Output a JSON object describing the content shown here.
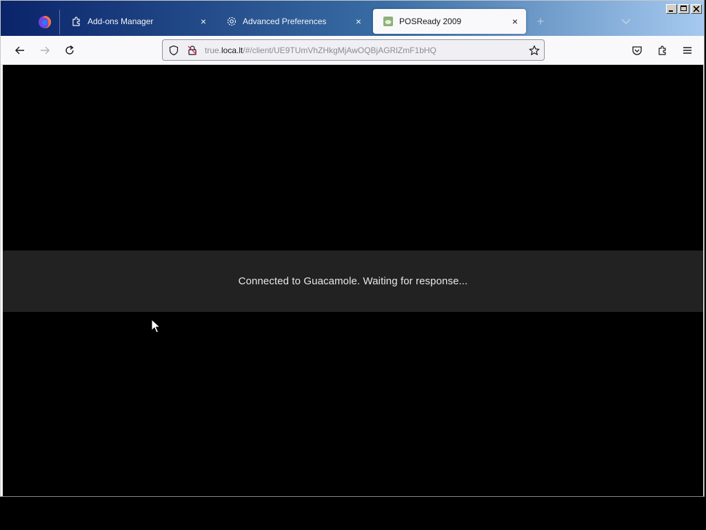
{
  "browser": {
    "tabs": [
      {
        "label": "Add-ons Manager",
        "icon": "puzzle-icon",
        "active": false
      },
      {
        "label": "Advanced Preferences",
        "icon": "gear-icon",
        "active": false
      },
      {
        "label": "POSReady 2009",
        "icon": "site-favicon",
        "active": true
      }
    ],
    "tab_close_glyph": "×",
    "new_tab_glyph": "+",
    "url": {
      "prefix": "true.",
      "host": "loca.lt",
      "path": "/#/client/UE9TUmVhZHkgMjAwOQBjAGRlZmF1bHQ"
    }
  },
  "page": {
    "status_message": "Connected to Guacamole. Waiting for response..."
  },
  "colors": {
    "tabbar_gradient": [
      "#0a246a",
      "#3a6ea5",
      "#a6caf0"
    ],
    "banner_bg": "#222222",
    "page_bg": "#000000"
  }
}
